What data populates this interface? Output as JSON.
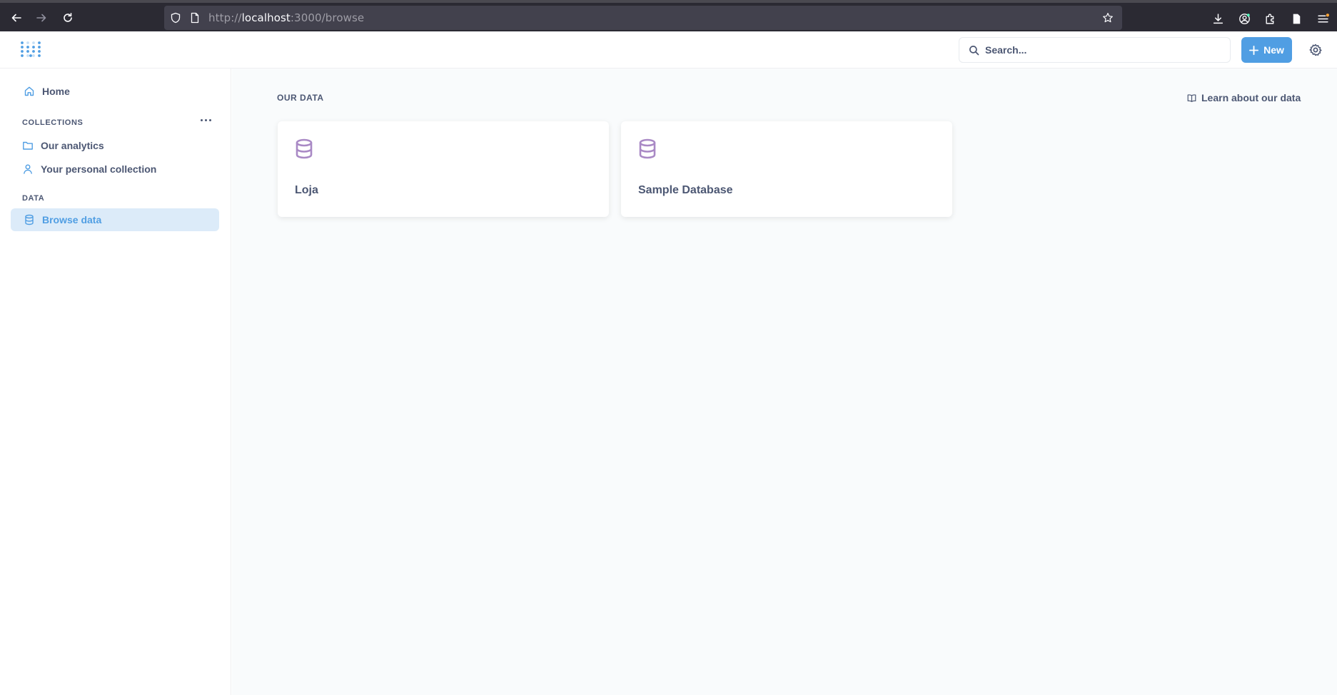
{
  "browser": {
    "url_scheme": "http://",
    "url_host": "localhost",
    "url_rest": ":3000/browse"
  },
  "header": {
    "search_placeholder": "Search...",
    "new_label": "New",
    "accent": "#509ee3"
  },
  "sidebar": {
    "home_label": "Home",
    "collections_heading": "COLLECTIONS",
    "collections": [
      {
        "label": "Our analytics",
        "icon": "folder-icon"
      },
      {
        "label": "Your personal collection",
        "icon": "person-icon"
      }
    ],
    "data_heading": "DATA",
    "browse_label": "Browse data"
  },
  "main": {
    "section_title": "OUR DATA",
    "learn_label": "Learn about our data",
    "databases": [
      {
        "name": "Loja",
        "icon": "database-icon"
      },
      {
        "name": "Sample Database",
        "icon": "database-icon"
      }
    ],
    "db_icon_color": "#a989c5"
  }
}
